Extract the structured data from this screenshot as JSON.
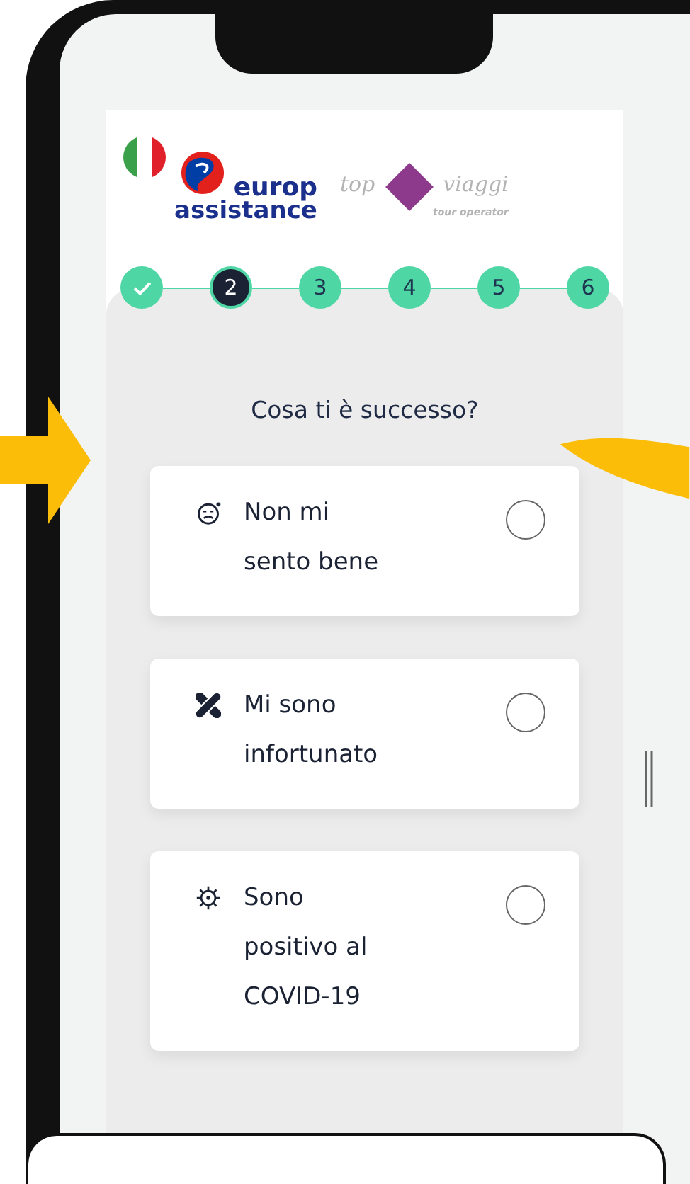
{
  "logos": {
    "brand": [
      "europ",
      "assistance"
    ],
    "partner": [
      "top",
      "viaggi",
      "tour operator"
    ]
  },
  "steps": [
    {
      "completed": true,
      "selected": false
    },
    {
      "label": "2",
      "completed": false,
      "selected": true
    },
    {
      "label": "3",
      "completed": false,
      "selected": false
    },
    {
      "label": "4",
      "completed": false,
      "selected": false
    },
    {
      "label": "5",
      "completed": false,
      "selected": false
    },
    {
      "label": "6",
      "completed": false,
      "selected": false
    }
  ],
  "question": "Cosa ti è successo?",
  "options": [
    {
      "kind": "sick",
      "label": "Non mi sento bene",
      "selected": false
    },
    {
      "kind": "injury",
      "label": "Mi sono infortunato",
      "selected": false
    },
    {
      "kind": "virus",
      "label": "Sono positivo al COVID-19",
      "selected": false
    }
  ]
}
